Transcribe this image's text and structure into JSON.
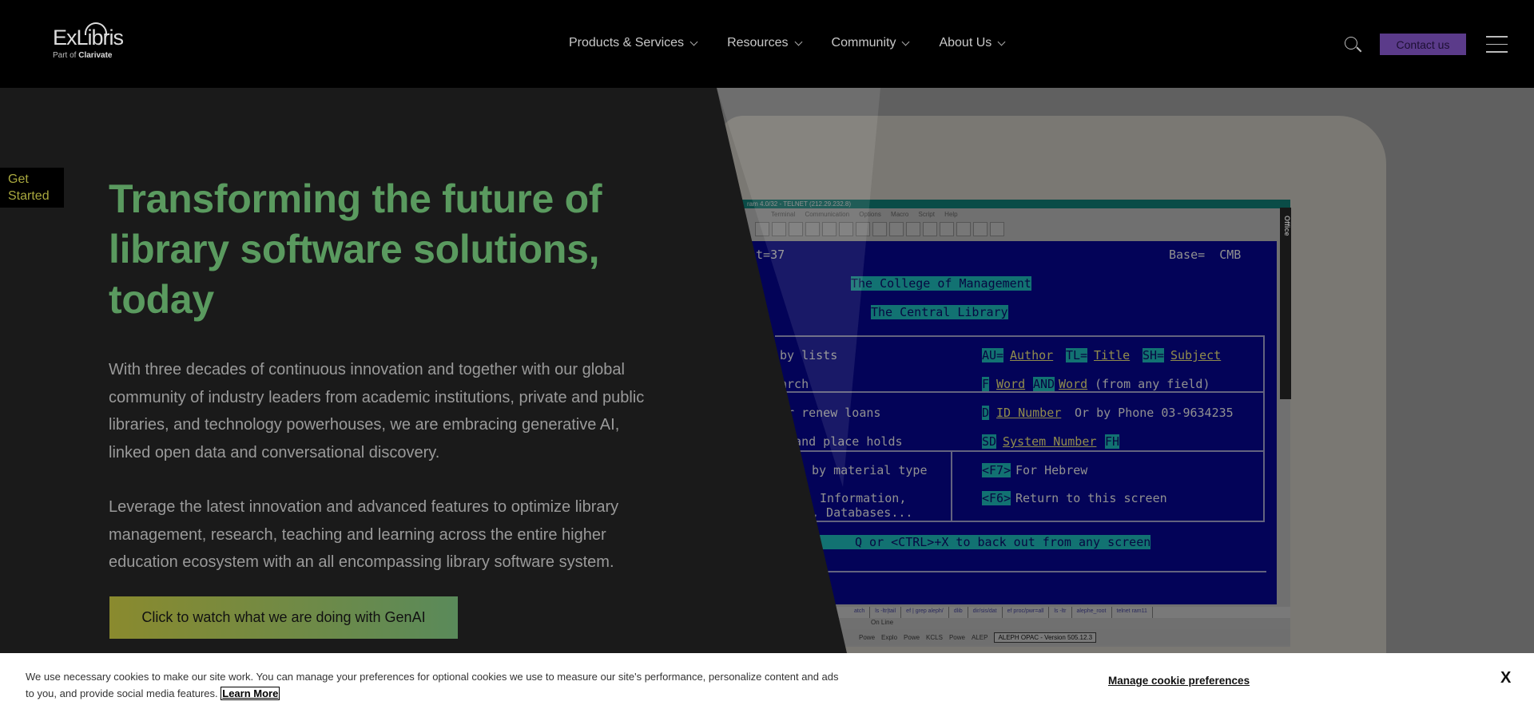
{
  "header": {
    "logo": {
      "name": "ExLibris",
      "tagline_prefix": "Part of",
      "tagline_brand": "Clarivate"
    },
    "nav": [
      {
        "label": "Products & Services"
      },
      {
        "label": "Resources"
      },
      {
        "label": "Community"
      },
      {
        "label": "About Us"
      }
    ],
    "contact_label": "Contact us",
    "icons": {
      "search": "search-icon",
      "menu": "hamburger-menu-icon"
    },
    "accent_color": "#5b3b8a"
  },
  "hero": {
    "get_started_line1": "Get",
    "get_started_line2": "Started",
    "title": "Transforming the future of library software solutions, today",
    "paragraph1": "With three decades of continuous innovation and together with our global community of industry leaders from academic institutions, private and public libraries, and technology powerhouses, we are embracing generative AI, linked open data and conversational discovery.",
    "paragraph2": "Leverage the latest innovation and advanced features to optimize library management, research, teaching and learning across the entire higher education ecosystem with an all encompassing library software system.",
    "cta_label": "Click to watch what we are doing with GenAI",
    "title_color": "#5a9a5f"
  },
  "hero_image": {
    "titlebar": "ram 4.0/32 - TELNET (212.29.232.8)",
    "menubar": "Terminal Communication Options Macro Script Help",
    "office_label": "Office",
    "screen": {
      "format": "at=37",
      "base": "Base=  CMB",
      "college": "The College of Management",
      "library": "The Central Library",
      "row1_left": "by lists",
      "row1_au": "AU=",
      "row1_author": "Author",
      "row1_tl": "TL=",
      "row1_title": "Title",
      "row1_sh": "SH=",
      "row1_subject": "Subject",
      "row2_left": "arch",
      "row2_f": "F",
      "row2_word1": "Word",
      "row2_and": "AND",
      "row2_word2": "Word",
      "row2_rest": "(from any field)",
      "row3_left": "or renew loans",
      "row3_d": "D",
      "row3_id": "ID Number",
      "row3_rest": "Or by Phone 03-9634235",
      "row4_left": "s and place holds",
      "row4_sd": "SD",
      "row4_sys": "System Number",
      "row4_fh": "FH",
      "row5_left": "by material type",
      "row5_key": "<F7>",
      "row5_rest": "For Hebrew",
      "row6_left": "Information,",
      "row6_left2": ", Databases...",
      "row6_key": "<F6>",
      "row6_rest": "Return to this screen",
      "footer": "Q or <CTRL>+X to back out from any screen"
    },
    "tabs": [
      "atch",
      "ls -ltr|tail",
      "ef | grep aleph/",
      "dlib",
      "dir/sis/dat",
      "ef proc/pwr=all",
      "ls -ltr",
      "alephe_root",
      "telnet ram11"
    ],
    "status": "On Line",
    "taskbar": [
      "Powe",
      "Explo",
      "Powe",
      "KCLS",
      "Powe",
      "ALEP"
    ],
    "taskbar_active": "ALEPH OPAC - Version 505.12.3"
  },
  "cookie_banner": {
    "text": "We use necessary cookies to make our site work. You can manage your preferences for optional cookies we use to measure our site's performance, personalize content and ads to you, and provide social media features.",
    "learn_more": "Learn More",
    "manage_label": "Manage cookie preferences",
    "close_label": "X"
  }
}
